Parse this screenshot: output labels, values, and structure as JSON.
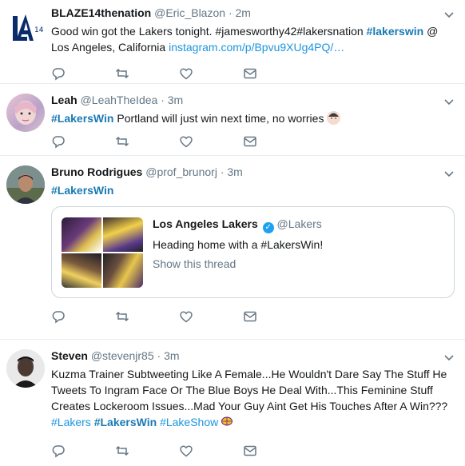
{
  "tweets": [
    {
      "name": "BLAZE14thenation",
      "handle": "@Eric_Blazon",
      "time": "2m",
      "text_before": "Good win got the Lakers tonight. #jamesworthy42#lakersnation ",
      "tag": "#lakerswin",
      "text_after": " @ Los Angeles, California ",
      "link": "instagram.com/p/Bpvu9XUg4PQ/…"
    },
    {
      "name": "Leah",
      "handle": "@LeahTheIdea",
      "time": "3m",
      "tag": "#LakersWin",
      "text_after": " Portland will just win next time, no worries"
    },
    {
      "name": "Bruno Rodrigues",
      "handle": "@prof_brunorj",
      "time": "3m",
      "tag": "#LakersWin",
      "quote": {
        "name": "Los Angeles Lakers",
        "handle": "@Lakers",
        "text": "Heading home with a #LakersWin!",
        "show": "Show this thread"
      }
    },
    {
      "name": "Steven",
      "handle": "@stevenjr85",
      "time": "3m",
      "text": "Kuzma Trainer Subtweeting Like A Female...He Wouldn't Dare Say The Stuff He Tweets To Ingram Face Or The Blue Boys He Deal With...This Feminine Stuff Creates Lockeroom Issues...Mad Your Guy Aint Get His Touches After A Win???",
      "tag1": "#Lakers",
      "tag2": "#LakersWin",
      "tag3": "#LakeShow"
    }
  ],
  "separator": "·",
  "icons": {
    "reply": "reply-icon",
    "retweet": "retweet-icon",
    "like": "heart-icon",
    "dm": "envelope-icon",
    "caret": "chevron-down-icon"
  },
  "colors": {
    "link": "#1b95e0",
    "muted": "#657786",
    "border": "#e6ecf0"
  }
}
